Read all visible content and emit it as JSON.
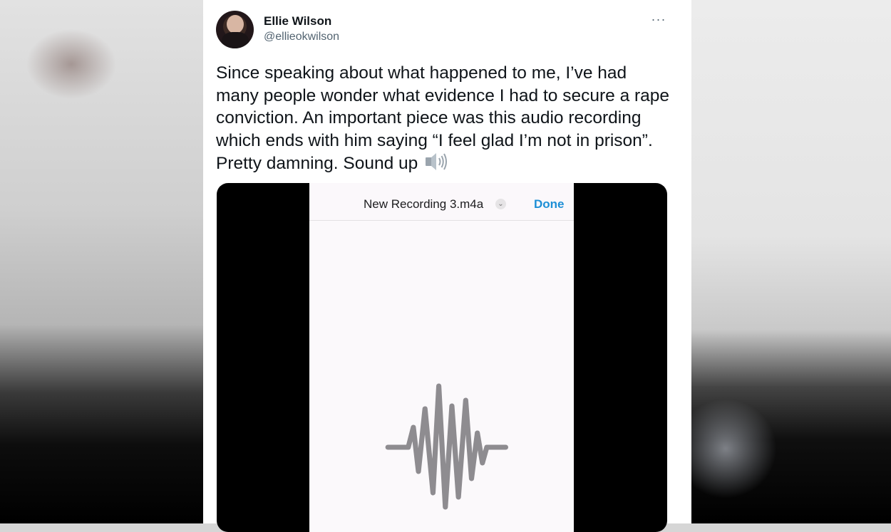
{
  "tweet": {
    "author_name": "Ellie Wilson",
    "author_handle": "@ellieokwilson",
    "more_label": "···",
    "text": "Since speaking about what happened to me, I’ve had many people wonder what evidence I had to secure a rape conviction. An important piece was this audio recording which ends with him saying “I feel glad I’m not in prison”. Pretty damning. Sound up",
    "emoji_icon": "speaker-high-volume-icon"
  },
  "media": {
    "recording_title": "New Recording 3.m4a",
    "done_label": "Done",
    "dropdown_icon": "chevron-down-icon",
    "accent_color": "#1e8fd6",
    "waveform_color": "#8e8c90"
  }
}
